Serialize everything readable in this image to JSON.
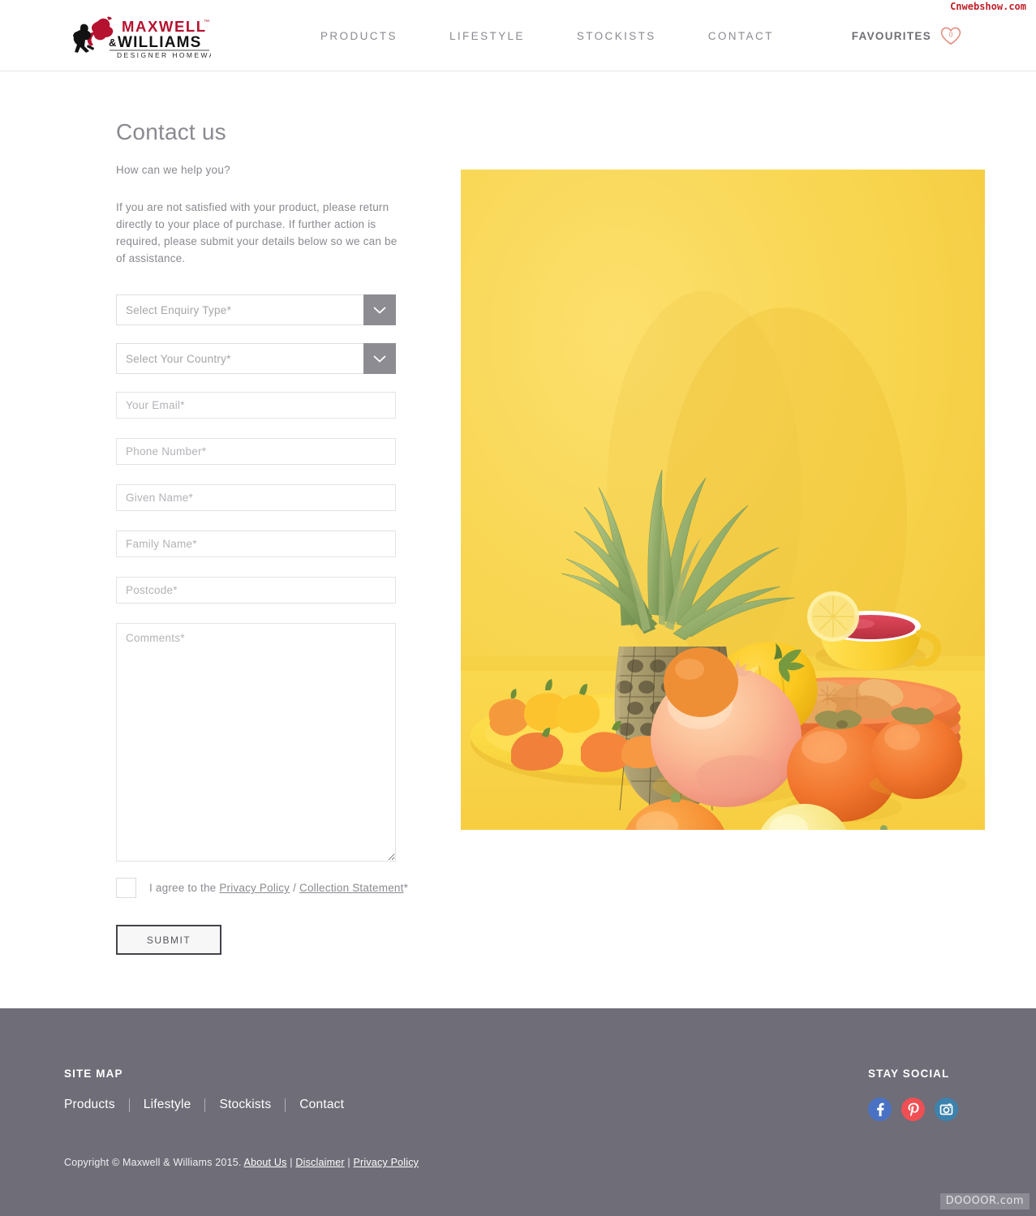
{
  "watermarks": {
    "top_right": "Cnwebshow.com",
    "bottom_right": "DOOOOR.com"
  },
  "header": {
    "logo": {
      "brand_line1": "MAXWELL",
      "brand_tm": "™",
      "brand_amp": "&",
      "brand_line2": "WILLIAMS",
      "tagline": "DESIGNER HOMEWARES",
      "brand_red": "#b5122f",
      "brand_black": "#111111"
    },
    "nav": [
      {
        "label": "PRODUCTS"
      },
      {
        "label": "LIFESTYLE"
      },
      {
        "label": "STOCKISTS"
      },
      {
        "label": "CONTACT"
      }
    ],
    "favourites": {
      "label": "FAVOURITES",
      "count": "0",
      "icon": "heart-icon",
      "color": "#e08878"
    }
  },
  "main": {
    "title": "Contact us",
    "subtitle": "How can we help you?",
    "intro": "If you are not satisfied with your product, please return directly to your place of purchase. If further action is required, please submit your details below so we can be of assistance.",
    "form": {
      "enquiry_type": {
        "placeholder": "Select Enquiry Type*",
        "value": ""
      },
      "country": {
        "placeholder": "Select Your Country*",
        "value": ""
      },
      "email": {
        "placeholder": "Your Email*",
        "value": ""
      },
      "phone": {
        "placeholder": "Phone Number*",
        "value": ""
      },
      "given_name": {
        "placeholder": "Given Name*",
        "value": ""
      },
      "family_name": {
        "placeholder": "Family Name*",
        "value": ""
      },
      "postcode": {
        "placeholder": "Postcode*",
        "value": ""
      },
      "comments": {
        "placeholder": "Comments*",
        "value": ""
      },
      "agree_prefix": "I agree to the ",
      "agree_link1": "Privacy Policy",
      "agree_divider": " / ",
      "agree_link2": "Collection Statement",
      "agree_suffix": "*",
      "agree_checked": false,
      "submit_label": "SUBMIT"
    }
  },
  "hero": {
    "alt": "Still life of citrus fruit, pineapple, yellow capsicum and a yellow teacup on a yellow background",
    "background": "#f7d34c"
  },
  "footer": {
    "sitemap_heading": "SITE MAP",
    "sitemap_links": [
      {
        "label": "Products"
      },
      {
        "label": "Lifestyle"
      },
      {
        "label": "Stockists"
      },
      {
        "label": "Contact"
      }
    ],
    "social_heading": "STAY SOCIAL",
    "social": [
      {
        "name": "facebook",
        "glyph": "f",
        "color": "#4a72c4"
      },
      {
        "name": "pinterest",
        "glyph": "P",
        "color": "#ef4f54"
      },
      {
        "name": "instagram",
        "glyph": "",
        "color": "#3d82ae"
      }
    ],
    "copyright_text": "Copyright © Maxwell & Williams 2015. ",
    "copyright_links": [
      {
        "label": "About Us"
      },
      {
        "label": "Disclaimer"
      },
      {
        "label": "Privacy Policy"
      }
    ],
    "background": "#6e6d78"
  }
}
